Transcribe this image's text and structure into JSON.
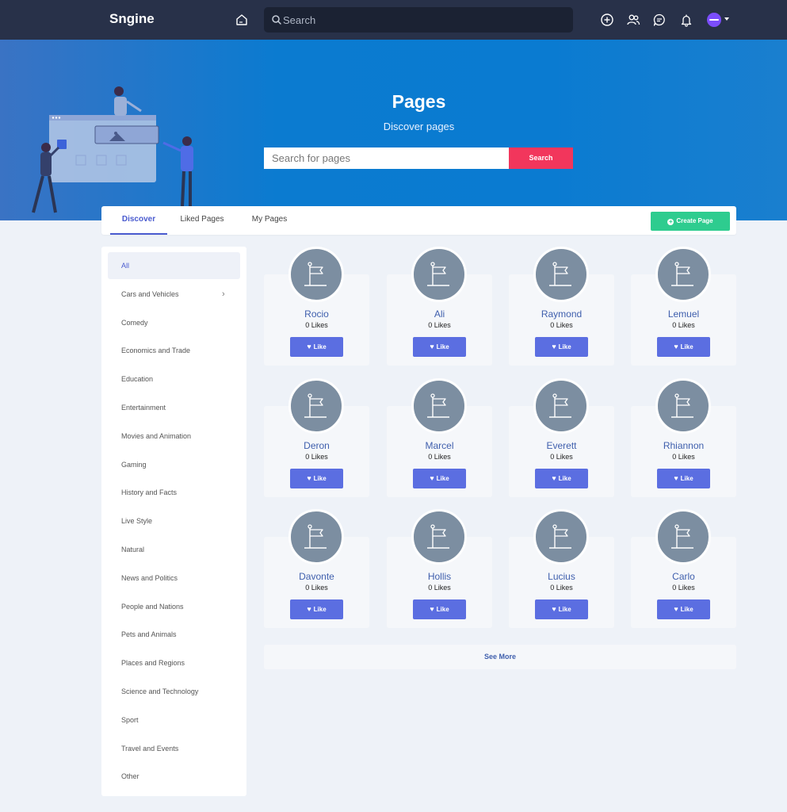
{
  "navbar": {
    "logo": "Sngine",
    "search_placeholder": "Search"
  },
  "hero": {
    "title": "Pages",
    "subtitle": "Discover pages",
    "search_placeholder": "Search for pages",
    "search_button": "Search"
  },
  "tabs": {
    "items": [
      "Discover",
      "Liked Pages",
      "My Pages"
    ],
    "active": "Discover",
    "create_button": "Create Page"
  },
  "categories": [
    "All",
    "Cars and Vehicles",
    "Comedy",
    "Economics and Trade",
    "Education",
    "Entertainment",
    "Movies and Animation",
    "Gaming",
    "History and Facts",
    "Live Style",
    "Natural",
    "News and Politics",
    "People and Nations",
    "Pets and Animals",
    "Places and Regions",
    "Science and Technology",
    "Sport",
    "Travel and Events",
    "Other"
  ],
  "pages": [
    {
      "name": "Rocio",
      "likes": "0 Likes"
    },
    {
      "name": "Ali",
      "likes": "0 Likes"
    },
    {
      "name": "Raymond",
      "likes": "0 Likes"
    },
    {
      "name": "Lemuel",
      "likes": "0 Likes"
    },
    {
      "name": "Deron",
      "likes": "0 Likes"
    },
    {
      "name": "Marcel",
      "likes": "0 Likes"
    },
    {
      "name": "Everett",
      "likes": "0 Likes"
    },
    {
      "name": "Rhiannon",
      "likes": "0 Likes"
    },
    {
      "name": "Davonte",
      "likes": "0 Likes"
    },
    {
      "name": "Hollis",
      "likes": "0 Likes"
    },
    {
      "name": "Lucius",
      "likes": "0 Likes"
    },
    {
      "name": "Carlo",
      "likes": "0 Likes"
    }
  ],
  "like_label": "Like",
  "see_more": "See More",
  "colors": {
    "navbar": "#283149",
    "hero": "#0b7bd0",
    "accent": "#5b6ee1",
    "search_button": "#f2365c",
    "create_button": "#2ecc8f"
  }
}
